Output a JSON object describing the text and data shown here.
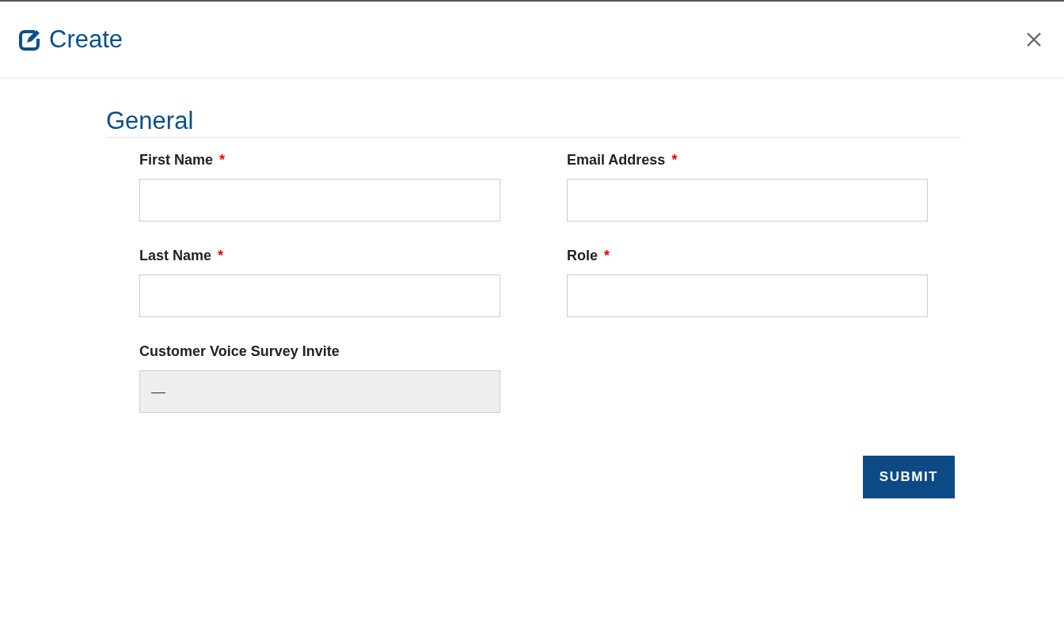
{
  "dialog": {
    "title": "Create"
  },
  "section": {
    "title": "General"
  },
  "fields": [
    {
      "label": "First Name",
      "required_mark": "*",
      "disabled": false
    },
    {
      "label": "Email Address",
      "required_mark": "*",
      "disabled": false
    },
    {
      "label": "Last Name",
      "required_mark": "*",
      "disabled": false
    },
    {
      "label": "Role",
      "required_mark": "*",
      "disabled": false
    },
    {
      "label": "Customer Voice Survey Invite",
      "disabled": true,
      "value": "—"
    }
  ],
  "buttons": [
    "SUBMIT"
  ]
}
